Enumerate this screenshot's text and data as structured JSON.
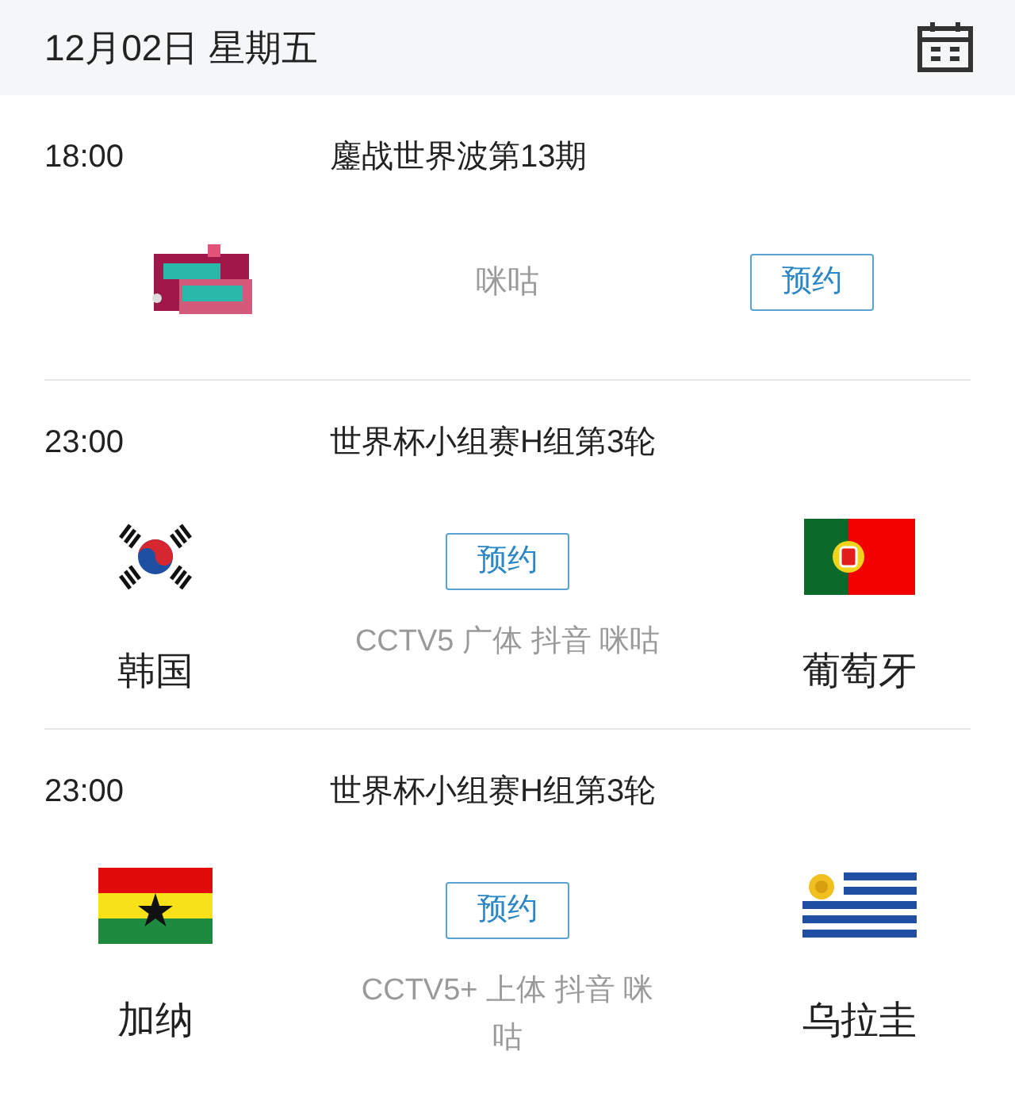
{
  "header": {
    "date": "12月02日 星期五"
  },
  "events": [
    {
      "kind": "show",
      "time": "18:00",
      "title": "鏖战世界波第13期",
      "channels": "咪咕",
      "button": "预约"
    },
    {
      "kind": "match",
      "time": "23:00",
      "title": "世界杯小组赛H组第3轮",
      "channels": "CCTV5 广体 抖音 咪咕",
      "button": "预约",
      "home": "韩国",
      "away": "葡萄牙"
    },
    {
      "kind": "match",
      "time": "23:00",
      "title": "世界杯小组赛H组第3轮",
      "channels": "CCTV5+ 上体 抖音 咪咕",
      "button": "预约",
      "home": "加纳",
      "away": "乌拉圭"
    }
  ]
}
